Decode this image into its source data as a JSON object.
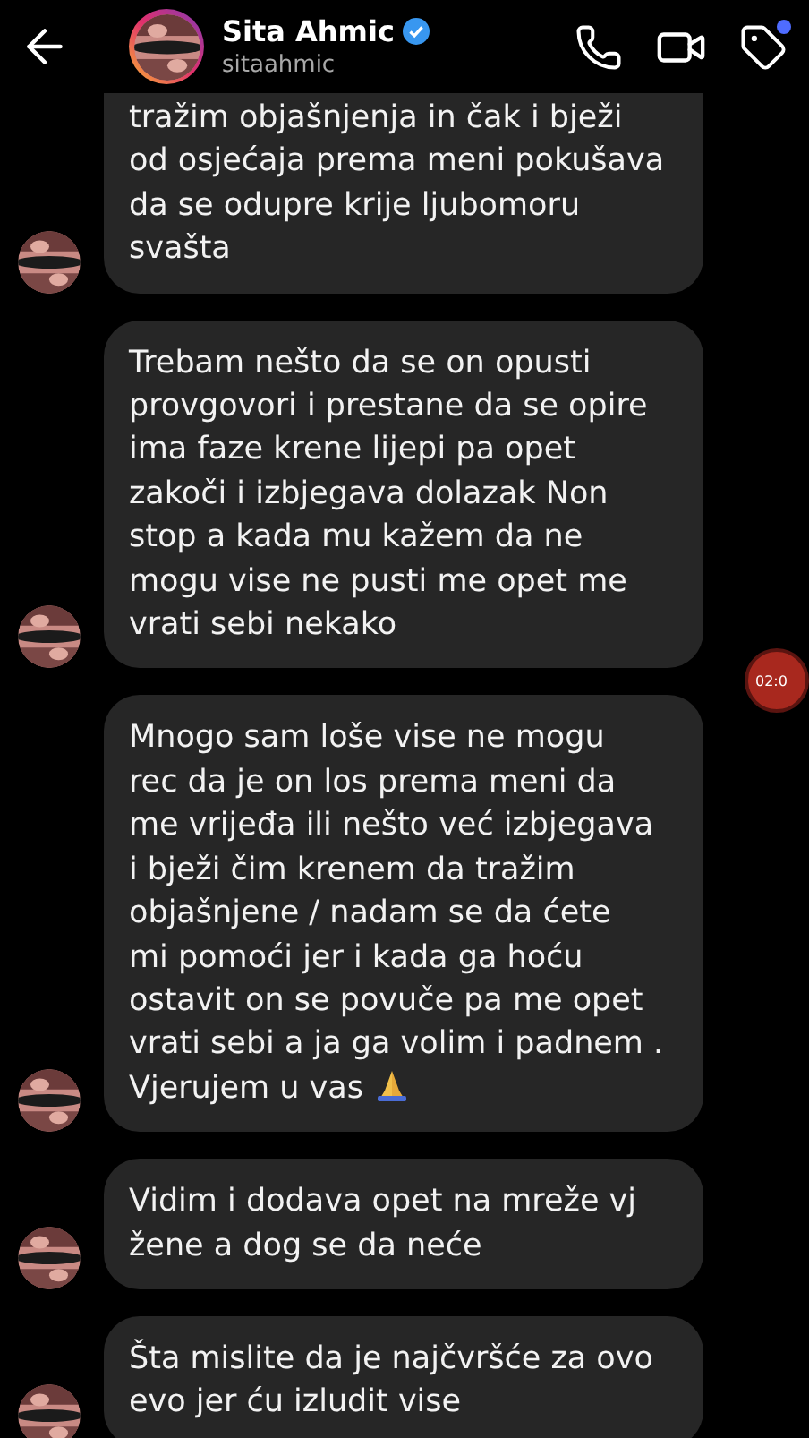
{
  "header": {
    "name": "Sita Ahmic",
    "verified": true,
    "username": "sitaahmic",
    "story_ring": true,
    "tag_notification": true
  },
  "messages": [
    {
      "text": "tražim objašnjenja in čak i bježi\nod osjećaja prema meni pokušava\nda se odupre krije ljubomoru\nsvašta",
      "cut_top": true
    },
    {
      "text": "Trebam nešto da se on opusti\nprovgovori i prestane da se opire\nima faze krene lijepi pa opet\nzakoči i izbjegava dolazak Non\nstop a kada mu kažem da ne\nmogu vise ne pusti me opet me\nvrati sebi nekako"
    },
    {
      "text": "Mnogo sam loše vise ne mogu\nrec da je on los prema meni da\nme vrijeđa ili nešto već izbjegava\ni bježi čim krenem da tražim\nobjašnjene / nadam se da ćete\nmi pomoći jer i kada ga hoću\nostavit on se povuče pa me opet\nvrati sebi a ja ga volim i padnem  .\nVjerujem u vas",
      "ends_with_emoji": true
    },
    {
      "text": "Vidim i dodava opet na mreže vj\nžene a dog se da neće"
    },
    {
      "text": "Šta mislite da je najčvršće za ovo\nevo jer ću izludit vise"
    }
  ],
  "recorder": {
    "time": "02:0"
  }
}
